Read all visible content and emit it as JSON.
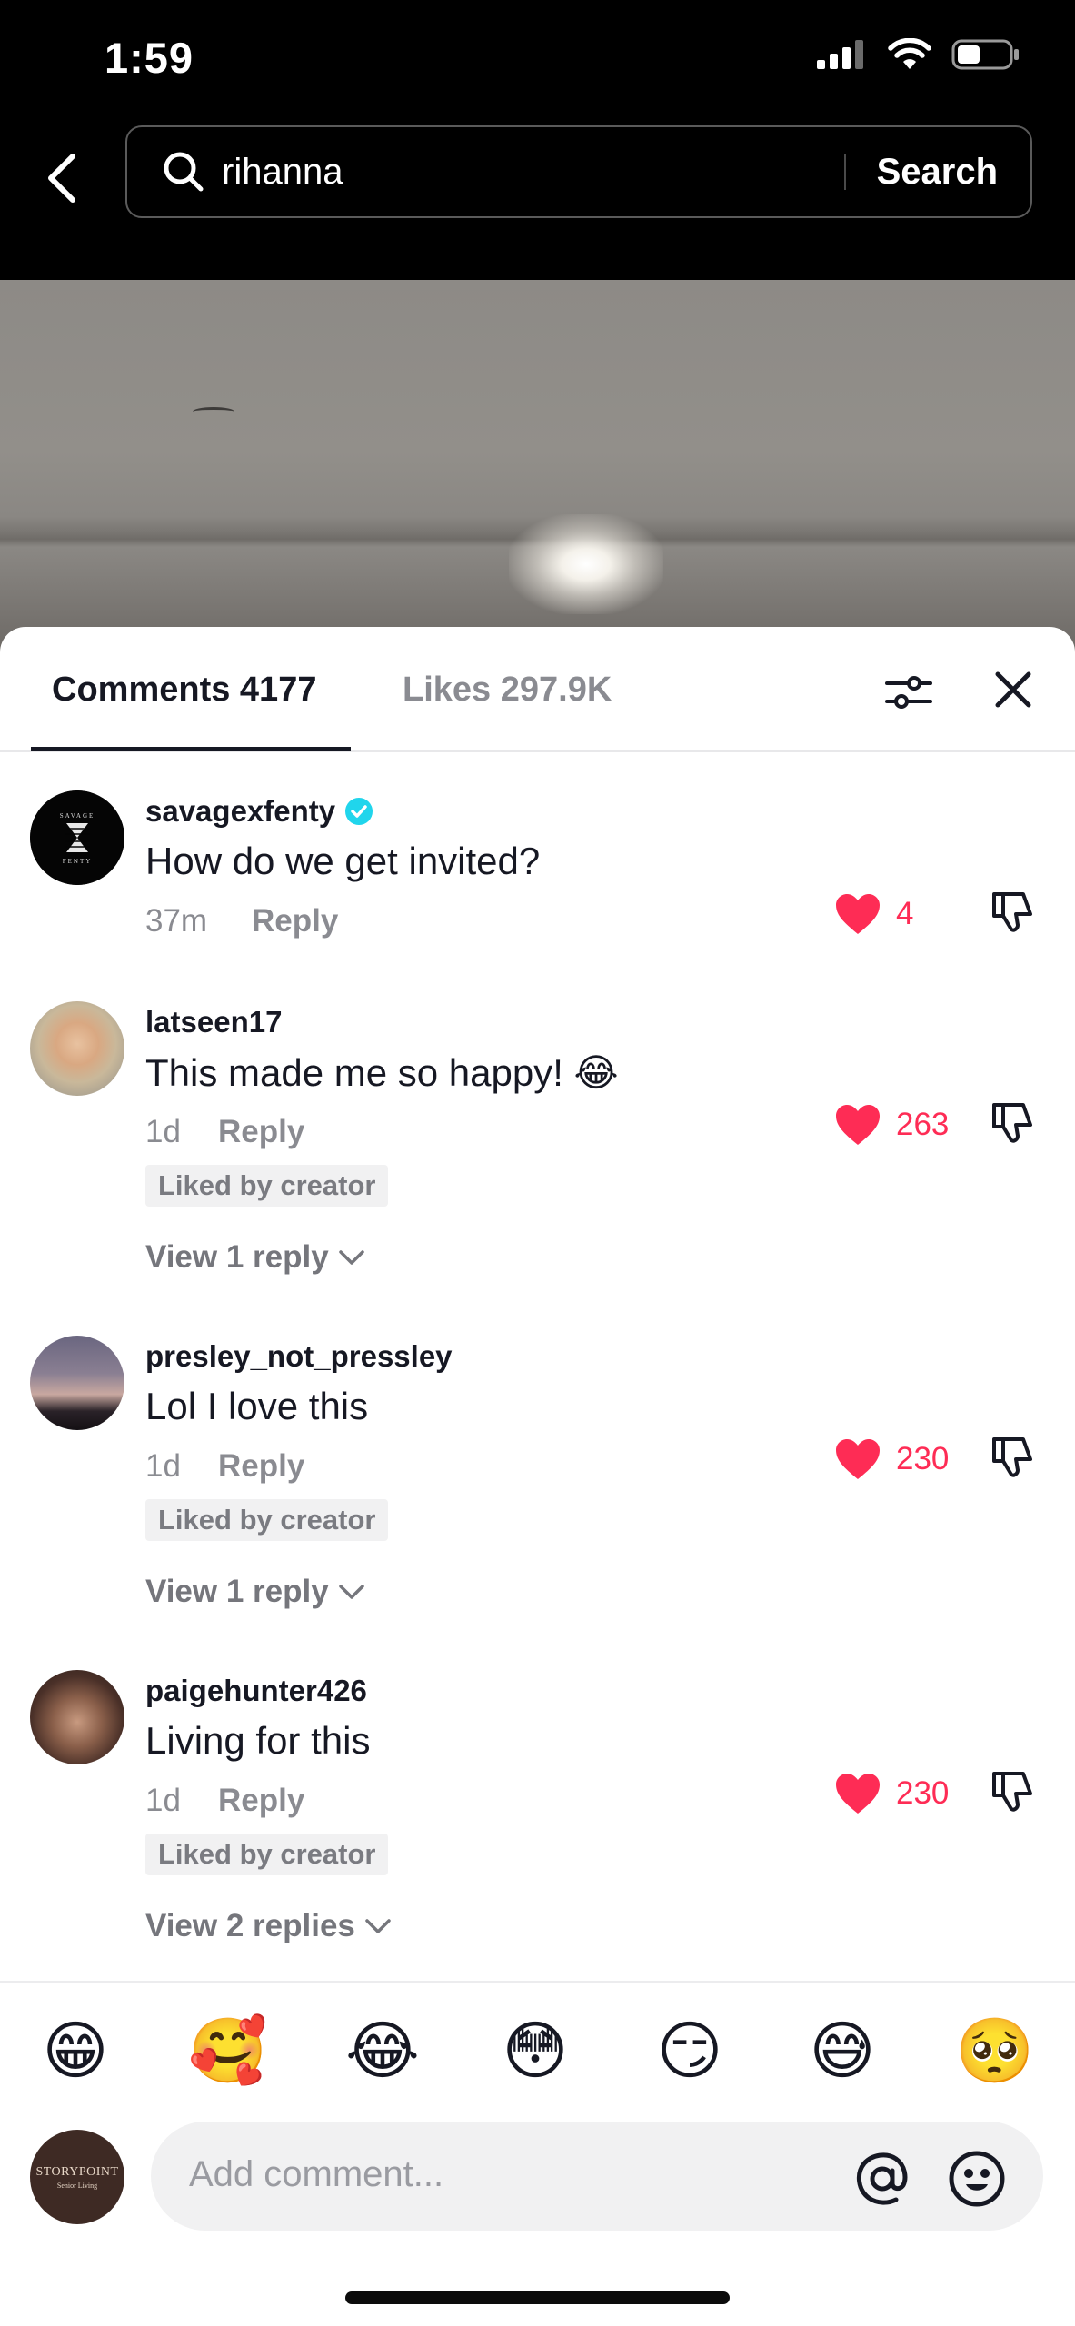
{
  "status_bar": {
    "time": "1:59"
  },
  "search": {
    "query": "rihanna",
    "button_label": "Search"
  },
  "tabs": {
    "comments_label": "Comments 4177",
    "likes_label": "Likes 297.9K"
  },
  "comments": [
    {
      "username": "savagexfenty",
      "verified": true,
      "text": "How do we get invited?",
      "time": "37m",
      "reply_label": "Reply",
      "likes": "4",
      "liked_by_creator": "",
      "view_replies": ""
    },
    {
      "username": "latseen17",
      "verified": false,
      "text": "This made me so happy! 😂",
      "time": "1d",
      "reply_label": "Reply",
      "likes": "263",
      "liked_by_creator": "Liked by creator",
      "view_replies": "View 1 reply"
    },
    {
      "username": "presley_not_pressley",
      "verified": false,
      "text": "Lol I love this",
      "time": "1d",
      "reply_label": "Reply",
      "likes": "230",
      "liked_by_creator": "Liked by creator",
      "view_replies": "View 1 reply"
    },
    {
      "username": "paigehunter426",
      "verified": false,
      "text": "Living for this",
      "time": "1d",
      "reply_label": "Reply",
      "likes": "230",
      "liked_by_creator": "Liked by creator",
      "view_replies": "View 2 replies"
    }
  ],
  "emoji_bar": [
    "😁",
    "🥰",
    "😂",
    "😳",
    "😏",
    "😅",
    "🥺"
  ],
  "composer": {
    "placeholder": "Add comment...",
    "avatar_text_line1": "STORYPOINT",
    "avatar_text_line2": "Senior Living"
  },
  "avatar_logo": {
    "line1": "SAVAGE",
    "line2": "FENTY"
  },
  "colors": {
    "accent_red": "#fe2c55",
    "verified_blue": "#20d5ec",
    "text_primary": "#161823",
    "text_secondary": "#8a8b91"
  },
  "icons": [
    "back-icon",
    "search-icon",
    "filter-icon",
    "close-icon",
    "heart-icon",
    "dislike-icon",
    "verified-icon",
    "chevron-down-icon",
    "mention-icon",
    "emoji-icon",
    "signal-icon",
    "wifi-icon",
    "battery-icon"
  ]
}
